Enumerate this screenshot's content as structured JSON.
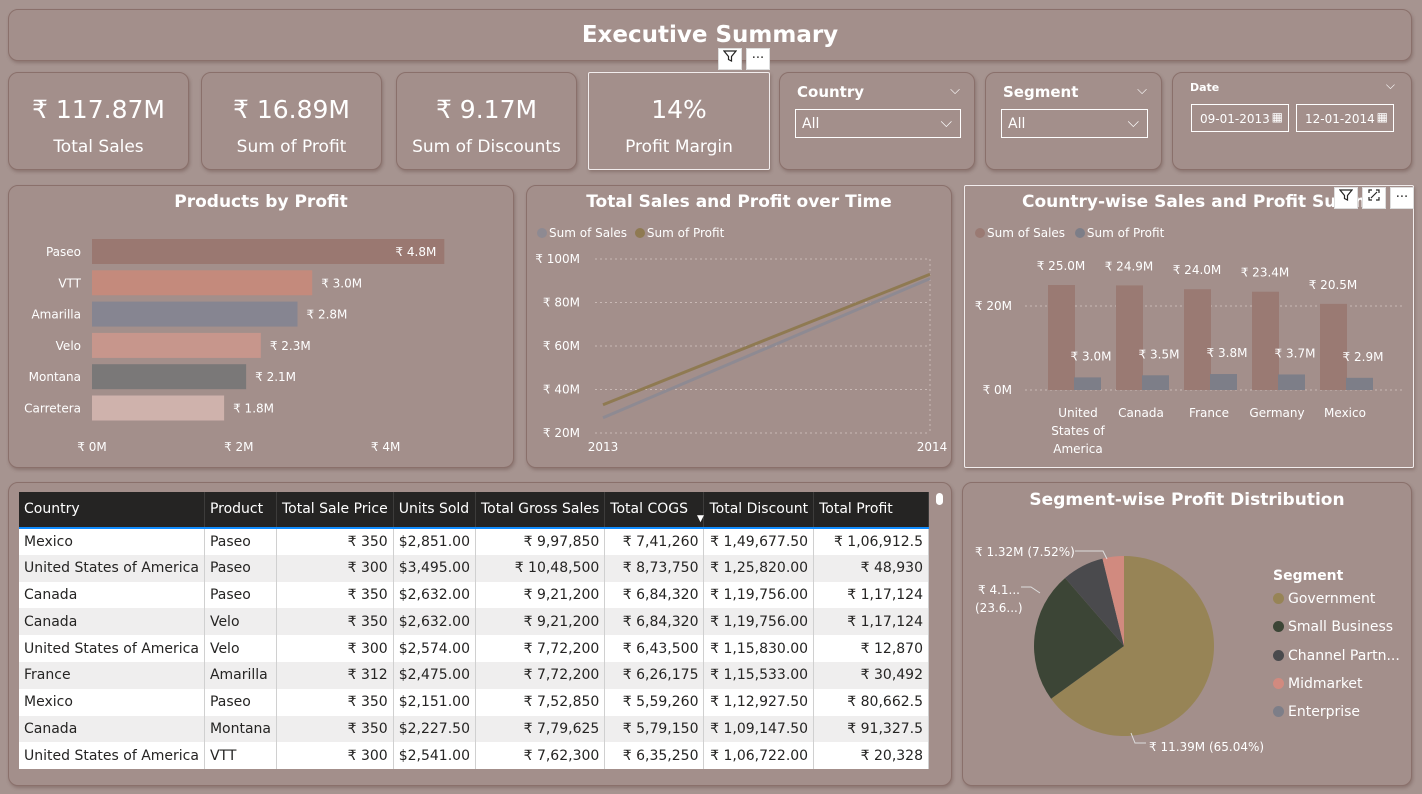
{
  "header": {
    "title": "Executive Summary"
  },
  "kpis": [
    {
      "value": "₹ 117.87M",
      "label": "Total  Sales"
    },
    {
      "value": "₹ 16.89M",
      "label": "Sum of  Profit"
    },
    {
      "value": "₹ 9.17M",
      "label": "Sum of  Discounts"
    },
    {
      "value": "14%",
      "label": "Profit Margin"
    }
  ],
  "slicers": {
    "country": {
      "label": "Country",
      "value": "All"
    },
    "segment": {
      "label": "Segment",
      "value": "All"
    },
    "date": {
      "label": "Date",
      "start": "09-01-2013",
      "end": "12-01-2014"
    }
  },
  "icons": {
    "filter": "filter-icon",
    "more": "more-options-icon",
    "focus": "focus-mode-icon",
    "calendar": "calendar-icon",
    "chevron": "chevron-down-icon"
  },
  "colors": {
    "background": "#a69490",
    "card": "#a38f8b",
    "sales": "#9a7a73",
    "profit": "#7d7e88",
    "accent": "#118dff"
  },
  "products_chart": {
    "title": "Products by Profit",
    "chart_data": {
      "type": "bar",
      "orientation": "horizontal",
      "categories": [
        "Paseo",
        "VTT",
        "Amarilla",
        "Velo",
        "Montana",
        "Carretera"
      ],
      "values": [
        4.8,
        3.0,
        2.8,
        2.3,
        2.1,
        1.8
      ],
      "labels": [
        "₹ 4.8M",
        "₹ 3.0M",
        "₹ 2.8M",
        "₹ 2.3M",
        "₹ 2.1M",
        "₹ 1.8M"
      ],
      "bar_colors": [
        "#9a7871",
        "#c48a7c",
        "#868591",
        "#c7968c",
        "#7a7878",
        "#cfb2ac"
      ],
      "xlim": [
        0,
        4.8
      ],
      "xticks": [
        0,
        2,
        4
      ],
      "xtick_labels": [
        "₹ 0M",
        "₹ 2M",
        "₹ 4M"
      ]
    }
  },
  "line_chart": {
    "title": "Total Sales and Profit over Time",
    "chart_data": {
      "type": "line",
      "x": [
        "2013",
        "2014"
      ],
      "series": [
        {
          "name": "Sum of  Sales",
          "values": [
            27,
            91
          ],
          "color": "#8e8a92"
        },
        {
          "name": "Sum of  Profit",
          "values": [
            33,
            93
          ],
          "color": "#8f7a52"
        }
      ],
      "ylim": [
        20,
        100
      ],
      "yticks": [
        20,
        40,
        60,
        80,
        100
      ],
      "ytick_labels": [
        "₹ 20M",
        "₹ 40M",
        "₹ 60M",
        "₹ 80M",
        "₹ 100M"
      ],
      "grid": true,
      "legend": "top-left"
    }
  },
  "country_chart": {
    "title": "Country-wise Sales and Profit Summary",
    "chart_data": {
      "type": "bar",
      "categories": [
        "United States of America",
        "Canada",
        "France",
        "Germany",
        "Mexico"
      ],
      "category_lines": [
        [
          "United",
          "States of",
          "America"
        ],
        [
          "Canada"
        ],
        [
          "France"
        ],
        [
          "Germany"
        ],
        [
          "Mexico"
        ]
      ],
      "series": [
        {
          "name": "Sum of  Sales",
          "values": [
            25.0,
            24.9,
            24.0,
            23.4,
            20.5
          ],
          "labels": [
            "₹ 25.0M",
            "₹ 24.9M",
            "₹ 24.0M",
            "₹ 23.4M",
            "₹ 20.5M"
          ],
          "color": "#9a7a73"
        },
        {
          "name": "Sum of  Profit",
          "values": [
            3.0,
            3.5,
            3.8,
            3.7,
            2.9
          ],
          "labels": [
            "₹ 3.0M",
            "₹ 3.5M",
            "₹ 3.8M",
            "₹ 3.7M",
            "₹ 2.9M"
          ],
          "color": "#7d7e88"
        }
      ],
      "ylim": [
        0,
        27.5
      ],
      "yticks": [
        0,
        20
      ],
      "ytick_labels": [
        "₹ 0M",
        "₹ 20M"
      ],
      "grid": true,
      "legend": "top-left"
    }
  },
  "table": {
    "columns": [
      "Country",
      "Product",
      "Total Sale Price",
      "Units Sold",
      "Total Gross Sales",
      "Total COGS",
      "Total Discount",
      "Total Profit"
    ],
    "rows": [
      [
        "Mexico",
        "Paseo",
        "₹ 350",
        "$2,851.00",
        "₹ 9,97,850",
        "₹ 7,41,260",
        "₹ 1,49,677.50",
        "₹ 1,06,912.5"
      ],
      [
        "United States of America",
        "Paseo",
        "₹ 300",
        "$3,495.00",
        "₹ 10,48,500",
        "₹ 8,73,750",
        "₹ 1,25,820.00",
        "₹ 48,930"
      ],
      [
        "Canada",
        "Paseo",
        "₹ 350",
        "$2,632.00",
        "₹ 9,21,200",
        "₹ 6,84,320",
        "₹ 1,19,756.00",
        "₹ 1,17,124"
      ],
      [
        "Canada",
        "Velo",
        "₹ 350",
        "$2,632.00",
        "₹ 9,21,200",
        "₹ 6,84,320",
        "₹ 1,19,756.00",
        "₹ 1,17,124"
      ],
      [
        "United States of America",
        "Velo",
        "₹ 300",
        "$2,574.00",
        "₹ 7,72,200",
        "₹ 6,43,500",
        "₹ 1,15,830.00",
        "₹ 12,870"
      ],
      [
        "France",
        "Amarilla",
        "₹ 312",
        "$2,475.00",
        "₹ 7,72,200",
        "₹ 6,26,175",
        "₹ 1,15,533.00",
        "₹ 30,492"
      ],
      [
        "Mexico",
        "Paseo",
        "₹ 350",
        "$2,151.00",
        "₹ 7,52,850",
        "₹ 5,59,260",
        "₹ 1,12,927.50",
        "₹ 80,662.5"
      ],
      [
        "Canada",
        "Montana",
        "₹ 350",
        "$2,227.50",
        "₹ 7,79,625",
        "₹ 5,79,150",
        "₹ 1,09,147.50",
        "₹ 91,327.5"
      ],
      [
        "United States of America",
        "VTT",
        "₹ 300",
        "$2,541.00",
        "₹ 7,62,300",
        "₹ 6,35,250",
        "₹ 1,06,722.00",
        "₹ 20,328"
      ]
    ]
  },
  "pie_chart": {
    "title": "Segment-wise Profit Distribution",
    "legend_title": "Segment",
    "chart_data": {
      "type": "pie",
      "labels": [
        "Government",
        "Small Business",
        "Channel Partn...",
        "Midmarket",
        "Enterprise"
      ],
      "values": [
        65.04,
        23.6,
        7.52,
        3.84,
        0
      ],
      "colors": [
        "#978456",
        "#3c4536",
        "#4a4a4d",
        "#d18a7f",
        "#7d7e88"
      ],
      "data_labels": [
        "₹ 11.39M (65.04%)",
        "₹ 4.1... (23.6...)",
        "₹ 1.32M (7.52%)"
      ],
      "legend": "right"
    }
  }
}
